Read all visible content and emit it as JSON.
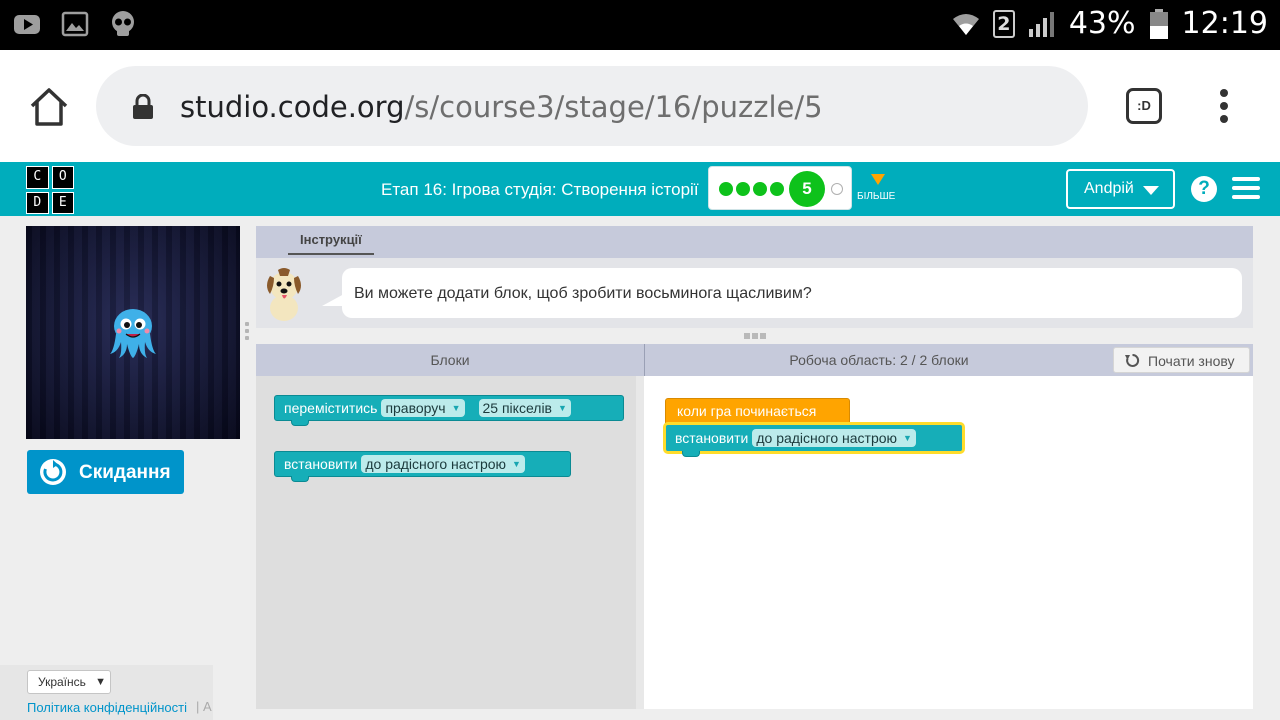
{
  "status_bar": {
    "battery": "43%",
    "time": "12:19",
    "sim": "2",
    "left_icons": [
      "youtube-icon",
      "gallery-icon",
      "skull-icon"
    ],
    "right_icons": [
      "wifi-icon",
      "sim-icon",
      "signal-icon",
      "battery-icon"
    ]
  },
  "browser": {
    "url_host": "studio.code.org",
    "url_path": "/s/course3/stage/16/puzzle/5",
    "extension_label": ":D"
  },
  "header": {
    "logo_letters": [
      "C",
      "O",
      "D",
      "E"
    ],
    "stage_title": "Етап 16: Ігрова студія: Створення історії",
    "current_level": "5",
    "completed_levels": 4,
    "more_label": "БІЛЬШЕ",
    "user_name": "Andрій",
    "help_label": "?",
    "colors": {
      "header": "#00adbc",
      "progress_green": "#0ec21b",
      "more_arrow": "#ffa400"
    }
  },
  "game": {
    "reset_label": "Скидання",
    "character": "octopus-happy"
  },
  "footer": {
    "language": "Українсь",
    "privacy_link": "Політика конфіденційності",
    "separator": "| А"
  },
  "instructions": {
    "tab_label": "Інструкції",
    "text": "Ви можете додати блок, щоб зробити восьминога щасливим?"
  },
  "workspace": {
    "toolbox_title": "Блоки",
    "workspace_title": "Робоча область: 2 / 2 блоки",
    "restart_label": "Почати знову",
    "toolbox_blocks": [
      {
        "label": "переміститись",
        "fields": [
          "праворуч",
          "25 пікселів"
        ]
      },
      {
        "label": "встановити",
        "fields": [
          "до радісного настрою"
        ]
      }
    ],
    "event_block": {
      "label": "коли гра починається"
    },
    "program_blocks": [
      {
        "label": "встановити",
        "fields": [
          "до радісного настрою"
        ]
      }
    ],
    "colors": {
      "action_block": "#16aeb8",
      "event_block": "#ffa400",
      "selection": "#ffdc2b"
    }
  }
}
